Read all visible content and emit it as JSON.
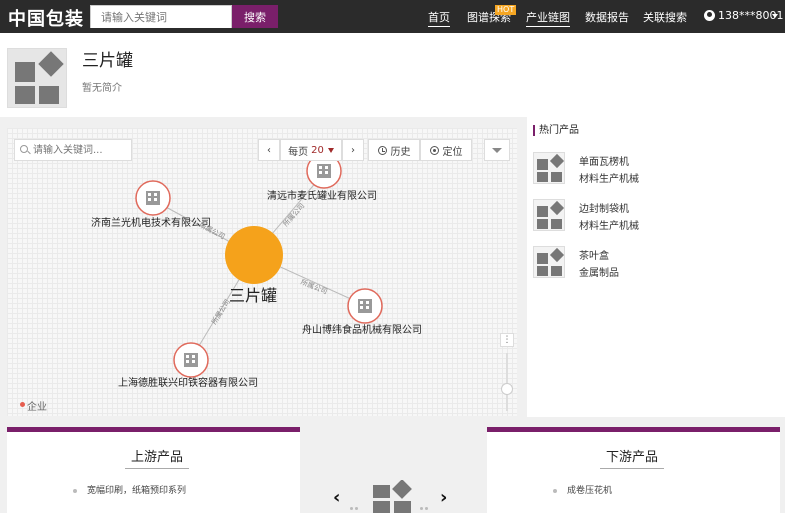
{
  "nav": {
    "logo": "中国包装",
    "search_placeholder": "请输入关键词",
    "search_button": "搜索",
    "items": [
      "首页",
      "图谱探索",
      "产业链图",
      "数据报告",
      "关联搜索"
    ],
    "hot_badge": "HOT",
    "user": "138***8001"
  },
  "product": {
    "title": "三片罐",
    "description": "暂无简介"
  },
  "graph": {
    "search_placeholder": "请输入关键词...",
    "per_page_label": "每页",
    "per_page_value": "20",
    "history_label": "历史",
    "locate_label": "定位",
    "center_node": "三片罐",
    "nodes": [
      "清远市麦氏罐业有限公司",
      "济南兰光机电技术有限公司",
      "舟山博纬食品机械有限公司",
      "上海德胜联兴印铁容器有限公司"
    ],
    "edge_labels": [
      "所属公司",
      "所属公司",
      "所属公司",
      "所属公司"
    ],
    "legend": "企业",
    "colors": {
      "center": "#f5a21b",
      "node_ring": "#e06a5c",
      "accent": "#7a1f6a"
    }
  },
  "hot_products": {
    "title": "热门产品",
    "items": [
      {
        "name": "单面瓦楞机",
        "category": "材料生产机械"
      },
      {
        "name": "边封制袋机",
        "category": "材料生产机械"
      },
      {
        "name": "茶叶盒",
        "category": "金属制品"
      }
    ]
  },
  "upstream": {
    "title": "上游产品",
    "items": [
      "宽幅印刷，纸箱预印系列"
    ]
  },
  "downstream": {
    "title": "下游产品",
    "items": [
      "成卷压花机"
    ]
  }
}
